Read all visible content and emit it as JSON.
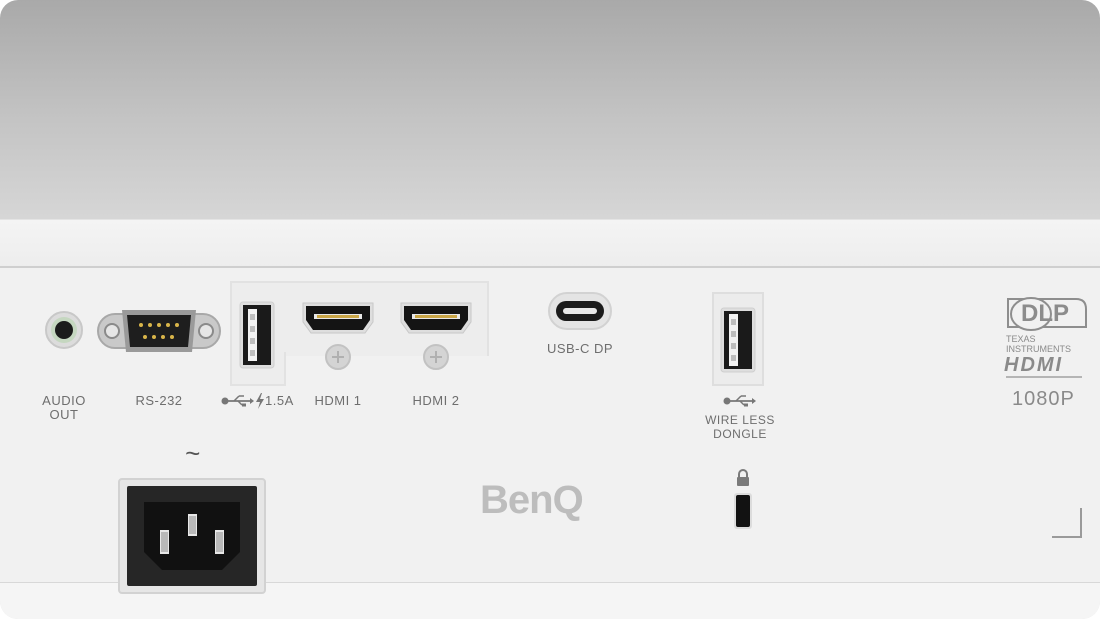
{
  "labels": {
    "audio_out": "AUDIO\nOUT",
    "rs232": "RS-232",
    "usb_power": "1.5A",
    "hdmi1": "HDMI 1",
    "hdmi2": "HDMI 2",
    "usbc": "USB-C DP",
    "wireless": "WIRE LESS\nDONGLE",
    "resolution": "1080P",
    "ac_symbol": "~"
  },
  "logos": {
    "brand": "BenQ",
    "dlp": "DLP",
    "texas": "TEXAS INSTRUMENTS",
    "hdmi_logo": "HDMI"
  },
  "icons": [
    "audio-jack-icon",
    "serial-port-icon",
    "usb-a-icon",
    "lightning-icon",
    "hdmi-port-icon",
    "usb-c-port-icon",
    "lock-icon",
    "kensington-slot-icon",
    "power-socket-icon"
  ]
}
